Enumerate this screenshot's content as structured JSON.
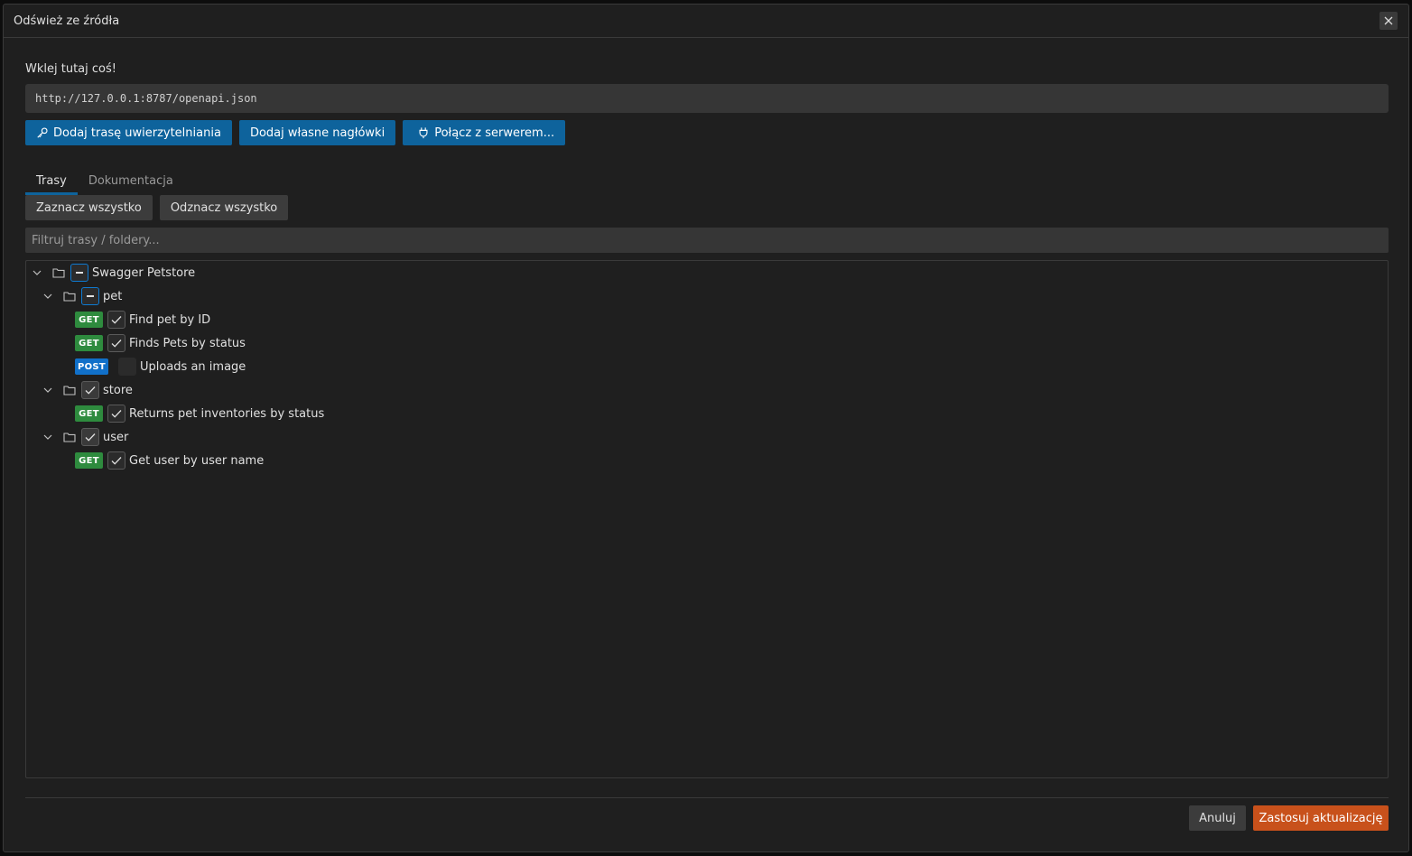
{
  "dialog": {
    "title": "Odśwież ze źródła",
    "close_icon": "close-icon"
  },
  "source": {
    "label": "Wklej tutaj coś!",
    "url_value": "http://127.0.0.1:8787/openapi.json"
  },
  "actions": {
    "add_auth_route": "Dodaj trasę uwierzytelniania",
    "add_headers": "Dodaj własne nagłówki",
    "connect_server": "Połącz z serwerem..."
  },
  "tabs": [
    "Trasy",
    "Dokumentacja"
  ],
  "selection": {
    "select_all": "Zaznacz wszystko",
    "deselect_all": "Odznacz wszystko"
  },
  "filter": {
    "placeholder": "Filtruj trasy / foldery..."
  },
  "tree": {
    "root": {
      "name": "Swagger Petstore",
      "state": "indeterminate"
    },
    "folders": [
      {
        "name": "pet",
        "state": "indeterminate",
        "routes": [
          {
            "method": "GET",
            "name": "Find pet by ID",
            "checked": true
          },
          {
            "method": "GET",
            "name": "Finds Pets by status",
            "checked": true
          },
          {
            "method": "POST",
            "name": "Uploads an image",
            "checked": false
          }
        ]
      },
      {
        "name": "store",
        "state": "checked",
        "routes": [
          {
            "method": "GET",
            "name": "Returns pet inventories by status",
            "checked": true
          }
        ]
      },
      {
        "name": "user",
        "state": "checked",
        "routes": [
          {
            "method": "GET",
            "name": "Get user by user name",
            "checked": true
          }
        ]
      }
    ]
  },
  "footer": {
    "cancel": "Anuluj",
    "apply": "Zastosuj aktualizację"
  },
  "colors": {
    "accent_blue": "#0e639c",
    "get_badge": "#2e8b3e",
    "post_badge": "#1170c9",
    "apply_button": "#c8511b"
  }
}
